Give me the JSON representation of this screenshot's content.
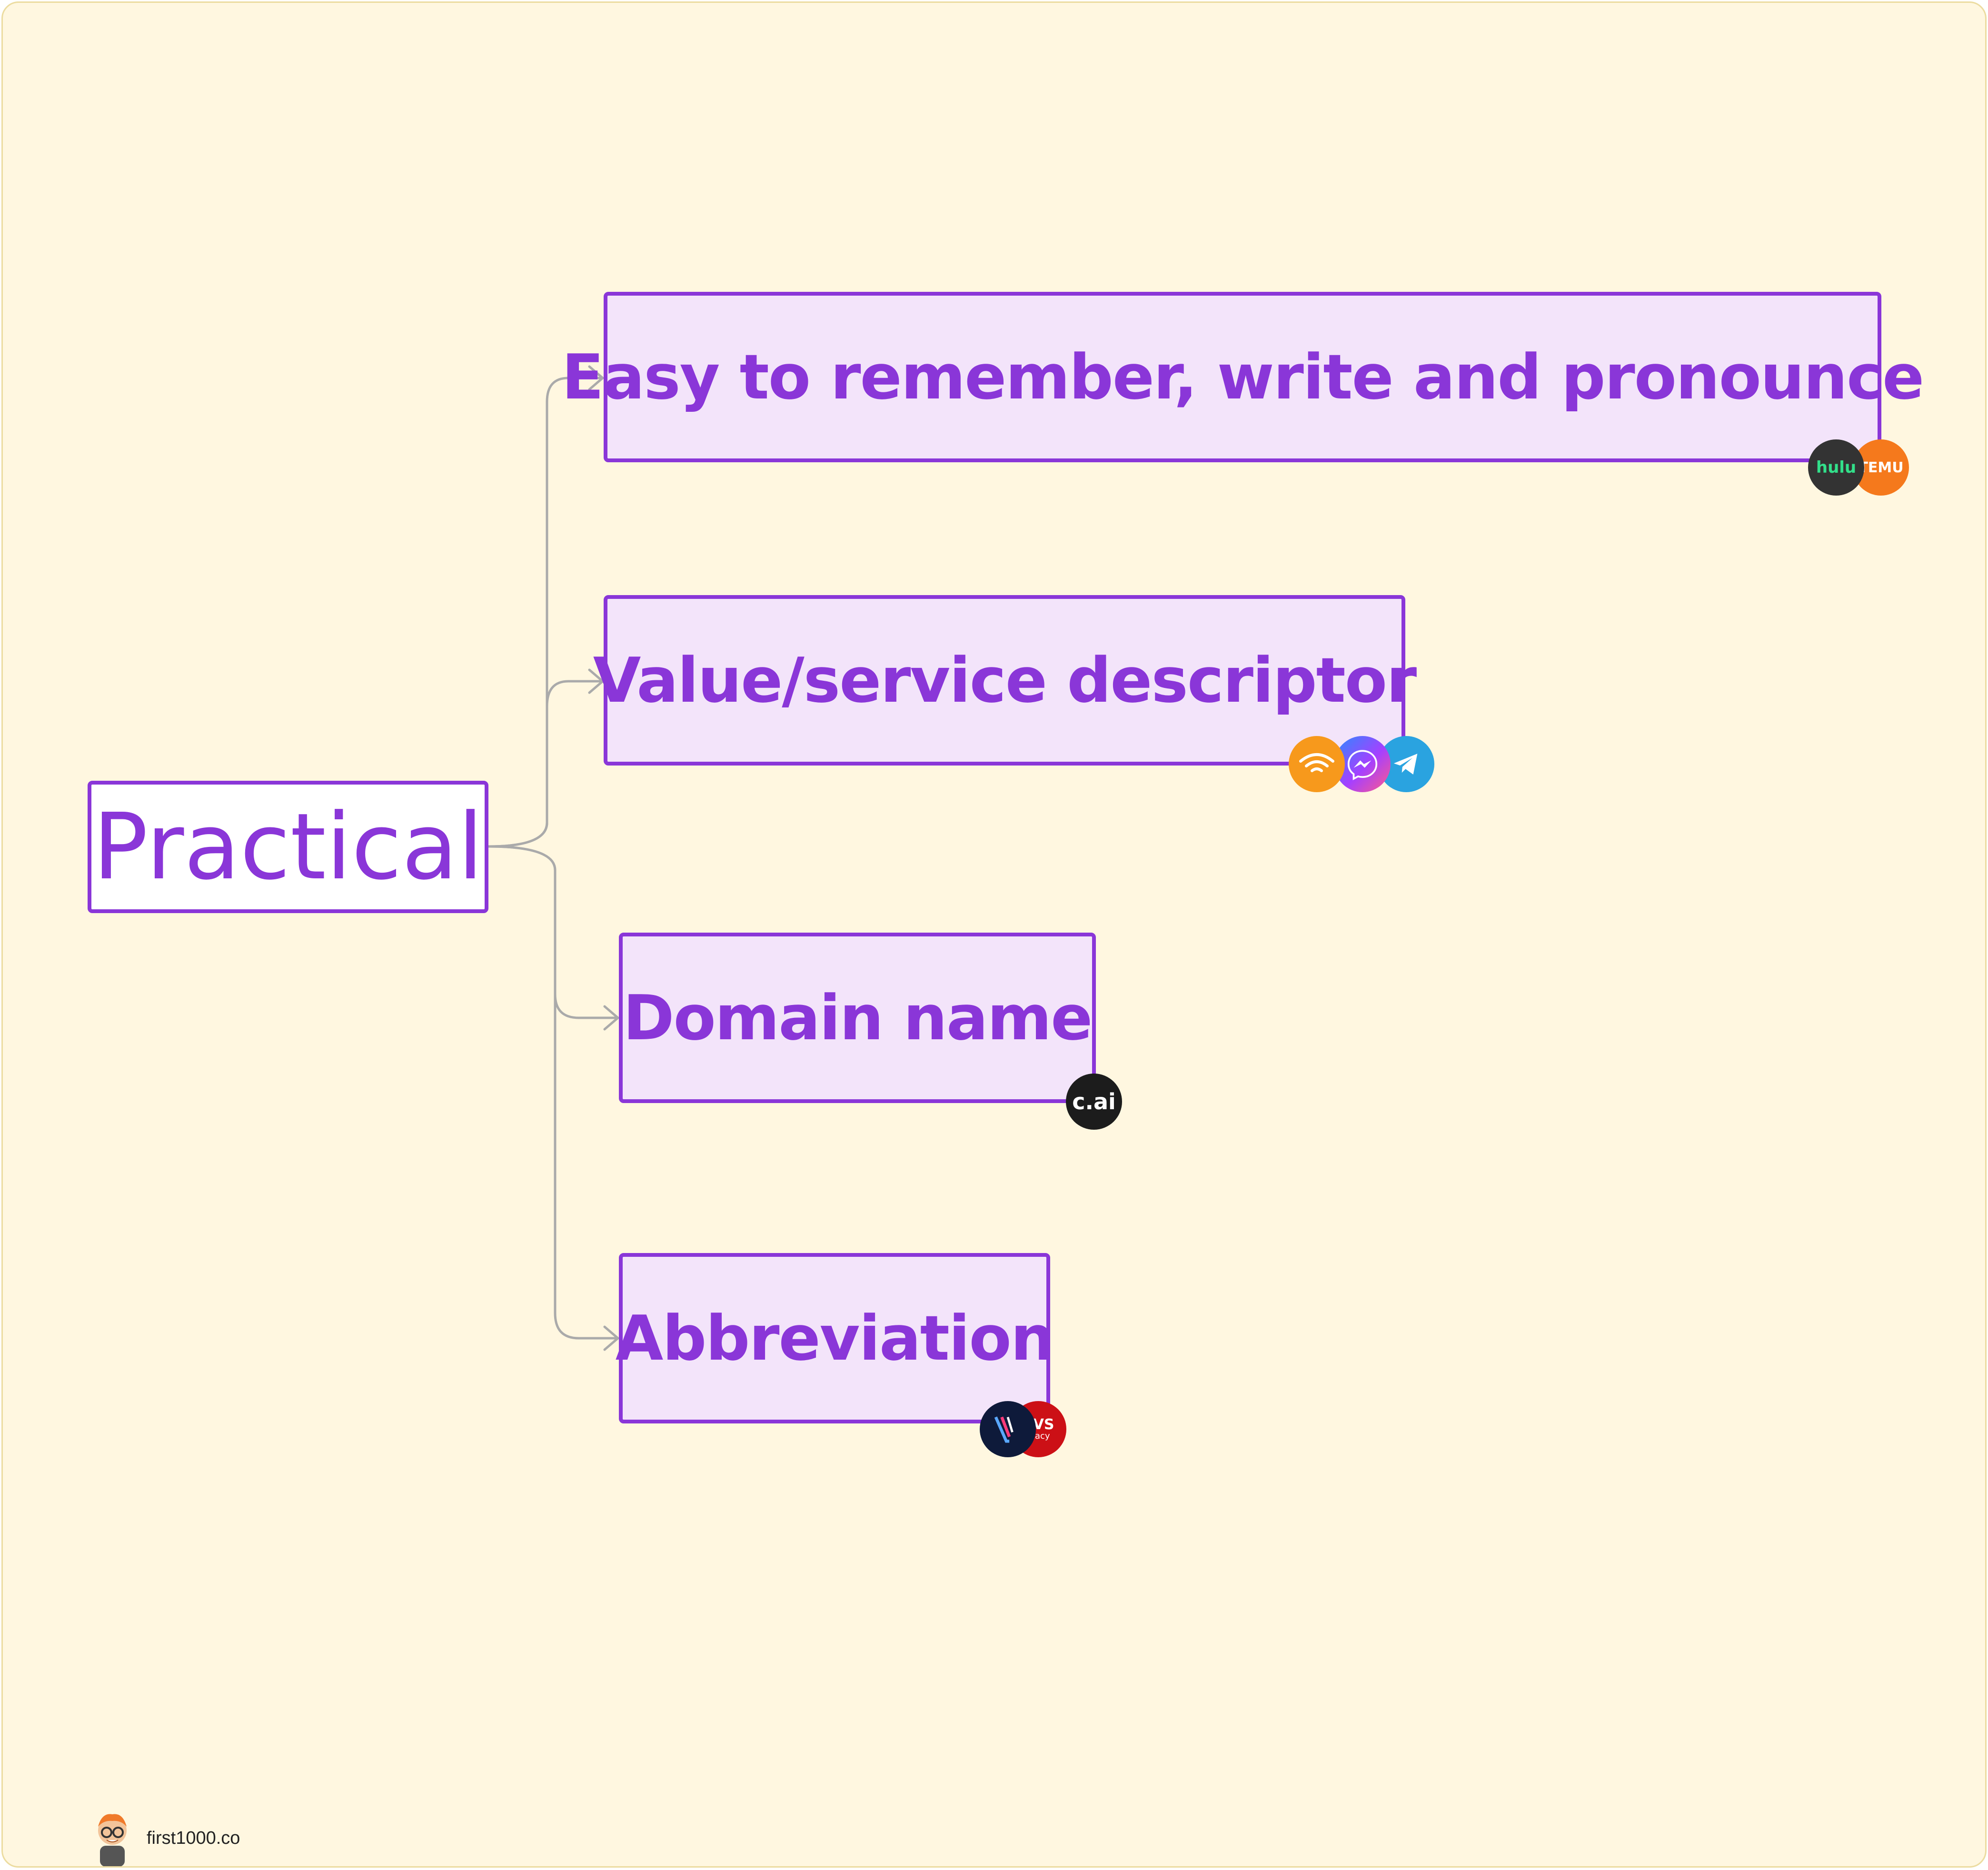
{
  "diagram": {
    "root": {
      "label": "Practical"
    },
    "branches": [
      {
        "label": "Easy to remember, write and pronounce",
        "badges": [
          "hulu-icon",
          "temu-icon"
        ]
      },
      {
        "label": "Value/service descriptor",
        "badges": [
          "audible-icon",
          "messenger-icon",
          "telegram-icon"
        ]
      },
      {
        "label": "Domain name",
        "badges": [
          "character-ai-icon"
        ]
      },
      {
        "label": "Abbreviation",
        "badges": [
          "vsco-icon",
          "cvs-pharmacy-icon"
        ]
      }
    ]
  },
  "badges": {
    "hulu": {
      "text": "hulu",
      "bg": "#333333",
      "fg": "#32e08a"
    },
    "temu": {
      "text": "TEMU",
      "bg": "#f5791c",
      "fg": "#ffffff"
    },
    "character_ai": {
      "text": "c.ai",
      "bg": "#1c1c1c",
      "fg": "#ffffff"
    },
    "cvs": {
      "text": "CVS",
      "sub": "macy",
      "bg": "#cc1016",
      "fg": "#ffffff"
    }
  },
  "colors": {
    "background": "#fff7e0",
    "accent": "#8a36d8",
    "node_fill": "#f3e4fa",
    "connector": "#aaaaaa"
  },
  "footer": {
    "brand": "first1000.co",
    "icon": "mascot-avatar-icon"
  }
}
